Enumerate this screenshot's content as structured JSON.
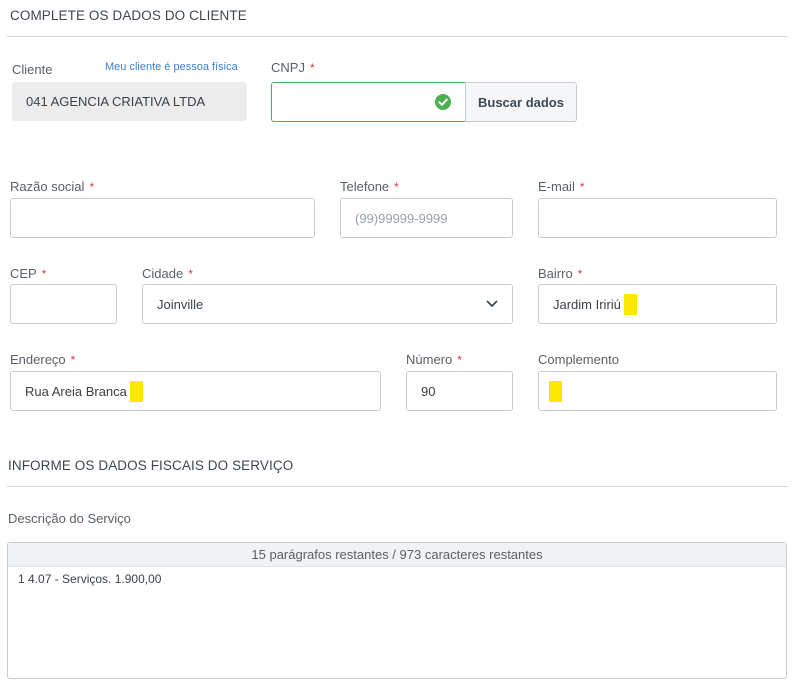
{
  "client_section": {
    "title": "COMPLETE OS DADOS DO CLIENTE",
    "cliente_label": "Cliente",
    "pessoa_fisica_link": "Meu cliente é pessoa física",
    "cliente_value": "041 AGENCIA CRIATIVA LTDA",
    "cnpj_label": "CNPJ",
    "cnpj_value": "",
    "buscar_button": "Buscar dados"
  },
  "fields": {
    "razao_social": {
      "label": "Razão social",
      "value": ""
    },
    "telefone": {
      "label": "Telefone",
      "placeholder": "(99)99999-9999"
    },
    "email": {
      "label": "E-mail",
      "value": ""
    },
    "cep": {
      "label": "CEP",
      "value": ""
    },
    "cidade": {
      "label": "Cidade",
      "value": "Joinville"
    },
    "bairro": {
      "label": "Bairro",
      "value": "Jardim Iririú"
    },
    "endereco": {
      "label": "Endereço",
      "value": "Rua Areia Branca"
    },
    "numero": {
      "label": "Número",
      "value": "90"
    },
    "complemento": {
      "label": "Complemento",
      "value": ""
    }
  },
  "required_mark": "*",
  "fiscal_section": {
    "title": "INFORME OS DADOS FISCAIS DO SERVIÇO",
    "descricao_label": "Descrição do Serviço",
    "counter_text": "15 parágrafos restantes / 973 caracteres restantes",
    "descricao_value": "1 4.07 - Serviços. 1.900,00"
  },
  "colors": {
    "valid_green": "#4caf50",
    "required_red": "#e0383e",
    "link_blue": "#3d7fd3",
    "highlight_yellow": "#ffe800"
  }
}
